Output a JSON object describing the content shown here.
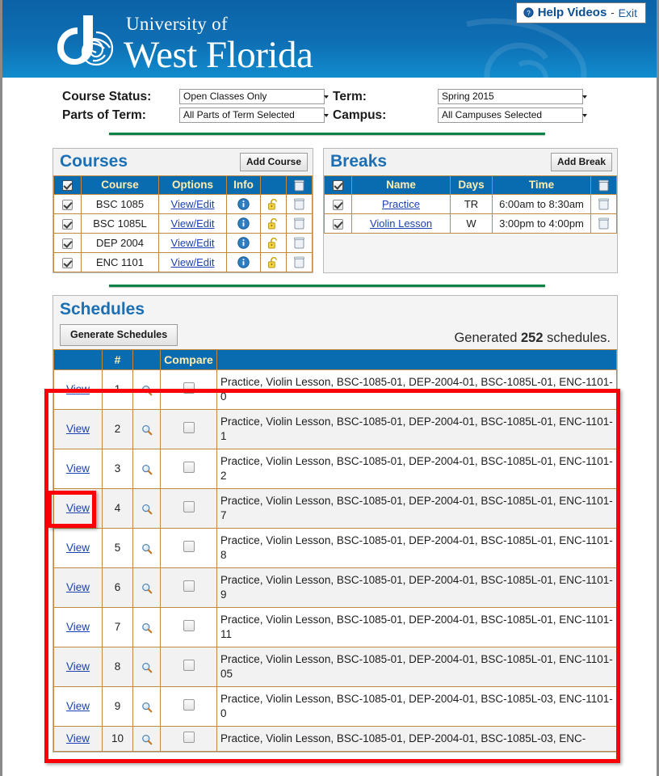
{
  "header": {
    "university_line1": "University of",
    "university_line2": "West Florida",
    "help_videos_label": "Help Videos",
    "separator": "-",
    "exit_label": "Exit",
    "help_icon": "help-circle-icon",
    "brand_blue": "#0d6aad",
    "accent_green": "#0d8346"
  },
  "filters": {
    "course_status_label": "Course Status:",
    "course_status_value": "Open Classes Only",
    "parts_of_term_label": "Parts of Term:",
    "parts_of_term_value": "All Parts of Term Selected",
    "term_label": "Term:",
    "term_value": "Spring 2015",
    "campus_label": "Campus:",
    "campus_value": "All Campuses Selected"
  },
  "courses": {
    "title": "Courses",
    "add_button": "Add Course",
    "columns": [
      "",
      "Course",
      "Options",
      "Info",
      "",
      ""
    ],
    "rows": [
      {
        "checked": true,
        "course": "BSC 1085",
        "options": "View/Edit",
        "info": "info-icon",
        "lock": "unlock-icon",
        "delete": "trash-icon"
      },
      {
        "checked": true,
        "course": "BSC 1085L",
        "options": "View/Edit",
        "info": "info-icon",
        "lock": "unlock-icon",
        "delete": "trash-icon"
      },
      {
        "checked": true,
        "course": "DEP 2004",
        "options": "View/Edit",
        "info": "info-icon",
        "lock": "unlock-icon",
        "delete": "trash-icon"
      },
      {
        "checked": true,
        "course": "ENC 1101",
        "options": "View/Edit",
        "info": "info-icon",
        "lock": "unlock-icon",
        "delete": "trash-icon"
      }
    ]
  },
  "breaks": {
    "title": "Breaks",
    "add_button": "Add Break",
    "columns": [
      "",
      "Name",
      "Days",
      "Time",
      ""
    ],
    "rows": [
      {
        "checked": true,
        "name": "Practice",
        "days": "TR",
        "time": "6:00am to 8:30am",
        "delete": "trash-icon"
      },
      {
        "checked": true,
        "name": "Violin Lesson",
        "days": "W",
        "time": "3:00pm to 4:00pm",
        "delete": "trash-icon"
      }
    ]
  },
  "schedules": {
    "title": "Schedules",
    "generate_button": "Generate Schedules",
    "generated_prefix": "Generated ",
    "generated_count": "252",
    "generated_suffix": " schedules.",
    "columns": [
      "",
      "#",
      "",
      "Compare",
      ""
    ],
    "view_label": "View",
    "rows": [
      {
        "num": "1",
        "desc": "Practice, Violin Lesson, BSC-1085-01, DEP-2004-01, BSC-1085L-01, ENC-1101-0"
      },
      {
        "num": "2",
        "desc": "Practice, Violin Lesson, BSC-1085-01, DEP-2004-01, BSC-1085L-01, ENC-1101-1"
      },
      {
        "num": "3",
        "desc": "Practice, Violin Lesson, BSC-1085-01, DEP-2004-01, BSC-1085L-01, ENC-1101-2"
      },
      {
        "num": "4",
        "desc": "Practice, Violin Lesson, BSC-1085-01, DEP-2004-01, BSC-1085L-01, ENC-1101-7"
      },
      {
        "num": "5",
        "desc": "Practice, Violin Lesson, BSC-1085-01, DEP-2004-01, BSC-1085L-01, ENC-1101-8"
      },
      {
        "num": "6",
        "desc": "Practice, Violin Lesson, BSC-1085-01, DEP-2004-01, BSC-1085L-01, ENC-1101-9"
      },
      {
        "num": "7",
        "desc": "Practice, Violin Lesson, BSC-1085-01, DEP-2004-01, BSC-1085L-01, ENC-1101-11"
      },
      {
        "num": "8",
        "desc": "Practice, Violin Lesson, BSC-1085-01, DEP-2004-01, BSC-1085L-01, ENC-1101-05"
      },
      {
        "num": "9",
        "desc": "Practice, Violin Lesson, BSC-1085-01, DEP-2004-01, BSC-1085L-03, ENC-1101-0"
      },
      {
        "num": "10",
        "desc": "Practice, Violin Lesson, BSC-1085-01, DEP-2004-01, BSC-1085L-03, ENC-"
      }
    ]
  },
  "annotations": {
    "highlight_color": "#fb0007",
    "main_region": "schedules-results-table",
    "target_element": "view-link-row-3"
  }
}
